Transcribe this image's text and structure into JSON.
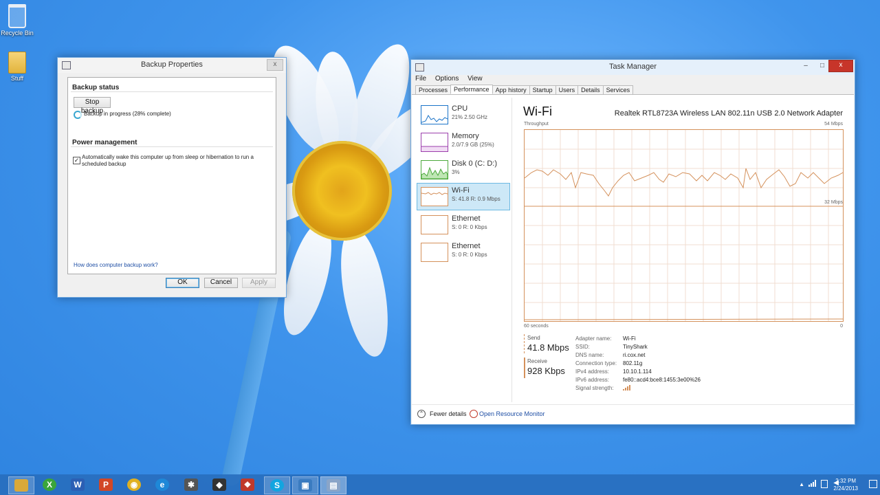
{
  "desktop": {
    "icons": [
      {
        "label": "Recycle Bin"
      },
      {
        "label": "Stuff"
      }
    ]
  },
  "backup_dialog": {
    "title": "Backup Properties",
    "close_glyph": "x",
    "status_section": "Backup status",
    "stop_button": "Stop backup",
    "progress_text": "Backup in progress (28% complete)",
    "progress_percent": 28,
    "power_section": "Power management",
    "wake_checkbox_label": "Automatically wake this computer up from sleep or hibernation to run a scheduled backup",
    "wake_checked": true,
    "help_link": "How does computer backup work?",
    "ok_button": "OK",
    "cancel_button": "Cancel",
    "apply_button": "Apply"
  },
  "task_manager": {
    "title": "Task Manager",
    "window_controls": {
      "minimize": "–",
      "maximize": "□",
      "close": "x"
    },
    "menu": [
      "File",
      "Options",
      "View"
    ],
    "tabs": [
      "Processes",
      "Performance",
      "App history",
      "Startup",
      "Users",
      "Details",
      "Services"
    ],
    "active_tab": "Performance",
    "sidebar": [
      {
        "name": "CPU",
        "value": "21% 2.50 GHz",
        "color": "#1a73c8"
      },
      {
        "name": "Memory",
        "value": "2.0/7.9 GB (25%)",
        "color": "#9b3dab"
      },
      {
        "name": "Disk 0 (C: D:)",
        "value": "3%",
        "color": "#4ba83a"
      },
      {
        "name": "Wi-Fi",
        "value": "S: 41.8 R: 0.9 Mbps",
        "color": "#d4905a"
      },
      {
        "name": "Ethernet",
        "value": "S: 0 R: 0 Kbps",
        "color": "#d4905a"
      },
      {
        "name": "Ethernet",
        "value": "S: 0 R: 0 Kbps",
        "color": "#d4905a"
      }
    ],
    "selected_item": "Wi-Fi",
    "main": {
      "title": "Wi-Fi",
      "adapter": "Realtek RTL8723A Wireless LAN 802.11n USB 2.0 Network Adapter",
      "graph_label": "Throughput",
      "graph_max": "54 Mbps",
      "graph_mid": "32 Mbps",
      "graph_time": "60 seconds",
      "graph_min": "0",
      "send_label": "Send",
      "send_value": "41.8 Mbps",
      "receive_label": "Receive",
      "receive_value": "928 Kbps",
      "info": [
        {
          "key": "Adapter name:",
          "value": "Wi-Fi"
        },
        {
          "key": "SSID:",
          "value": "TinyShark"
        },
        {
          "key": "DNS name:",
          "value": "ri.cox.net"
        },
        {
          "key": "Connection type:",
          "value": "802.11g"
        },
        {
          "key": "IPv4 address:",
          "value": "10.10.1.114"
        },
        {
          "key": "IPv6 address:",
          "value": "fe80::acd4:bce8:1455:3e00%26"
        },
        {
          "key": "Signal strength:",
          "value": ""
        }
      ]
    },
    "fewer_details": "Fewer details",
    "open_resource_monitor": "Open Resource Monitor"
  },
  "taskbar": {
    "apps": [
      {
        "name": "file-explorer-icon",
        "color": "#d9a93a",
        "glyph": ""
      },
      {
        "name": "xbox-icon",
        "color": "#3aa53a",
        "glyph": "X"
      },
      {
        "name": "word-icon",
        "color": "#2b5fb4",
        "glyph": "W"
      },
      {
        "name": "powerpoint-icon",
        "color": "#d24726",
        "glyph": "P"
      },
      {
        "name": "chrome-icon",
        "color": "#e0b020",
        "glyph": "◉"
      },
      {
        "name": "ie-icon",
        "color": "#1e88d8",
        "glyph": "e"
      },
      {
        "name": "app-icon",
        "color": "#555555",
        "glyph": "✱"
      },
      {
        "name": "app-icon",
        "color": "#333333",
        "glyph": "◆"
      },
      {
        "name": "app-icon",
        "color": "#c03a2b",
        "glyph": "❖"
      },
      {
        "name": "skype-icon",
        "color": "#12a5e0",
        "glyph": "S"
      },
      {
        "name": "backup-app-icon",
        "color": "#3a7bc0",
        "glyph": "▣"
      },
      {
        "name": "task-manager-icon",
        "color": "#8aa5c8",
        "glyph": "▤"
      }
    ],
    "time": "2:32 PM",
    "date": "2/24/2013"
  }
}
